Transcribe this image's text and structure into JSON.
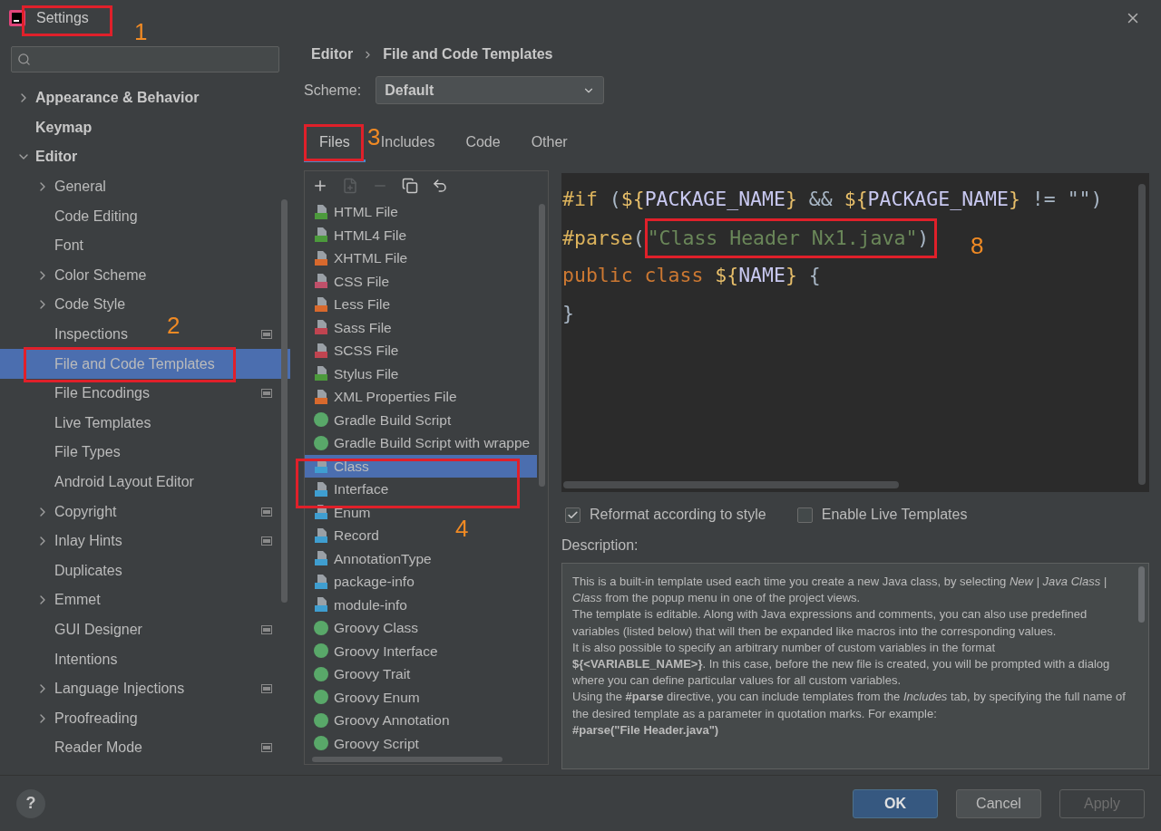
{
  "window": {
    "title": "Settings"
  },
  "sidebar": {
    "items": [
      {
        "label": "Appearance & Behavior",
        "expandable": true,
        "expanded": false,
        "selected": false,
        "project_badge": false
      },
      {
        "label": "Keymap",
        "expandable": false,
        "selected": false,
        "project_badge": false
      },
      {
        "label": "Editor",
        "expandable": true,
        "expanded": true,
        "selected": false,
        "project_badge": false,
        "children": [
          {
            "label": "General",
            "expandable": true,
            "expanded": false,
            "selected": false,
            "project_badge": false
          },
          {
            "label": "Code Editing",
            "expandable": false,
            "selected": false,
            "project_badge": false
          },
          {
            "label": "Font",
            "expandable": false,
            "selected": false,
            "project_badge": false
          },
          {
            "label": "Color Scheme",
            "expandable": true,
            "expanded": false,
            "selected": false,
            "project_badge": false
          },
          {
            "label": "Code Style",
            "expandable": true,
            "expanded": false,
            "selected": false,
            "project_badge": false
          },
          {
            "label": "Inspections",
            "expandable": false,
            "selected": false,
            "project_badge": true
          },
          {
            "label": "File and Code Templates",
            "expandable": false,
            "selected": true,
            "project_badge": false
          },
          {
            "label": "File Encodings",
            "expandable": false,
            "selected": false,
            "project_badge": true
          },
          {
            "label": "Live Templates",
            "expandable": false,
            "selected": false,
            "project_badge": false
          },
          {
            "label": "File Types",
            "expandable": false,
            "selected": false,
            "project_badge": false
          },
          {
            "label": "Android Layout Editor",
            "expandable": false,
            "selected": false,
            "project_badge": false
          },
          {
            "label": "Copyright",
            "expandable": true,
            "expanded": false,
            "selected": false,
            "project_badge": true
          },
          {
            "label": "Inlay Hints",
            "expandable": true,
            "expanded": false,
            "selected": false,
            "project_badge": true
          },
          {
            "label": "Duplicates",
            "expandable": false,
            "selected": false,
            "project_badge": false
          },
          {
            "label": "Emmet",
            "expandable": true,
            "expanded": false,
            "selected": false,
            "project_badge": false
          },
          {
            "label": "GUI Designer",
            "expandable": false,
            "selected": false,
            "project_badge": true
          },
          {
            "label": "Intentions",
            "expandable": false,
            "selected": false,
            "project_badge": false
          },
          {
            "label": "Language Injections",
            "expandable": true,
            "expanded": false,
            "selected": false,
            "project_badge": true
          },
          {
            "label": "Proofreading",
            "expandable": true,
            "expanded": false,
            "selected": false,
            "project_badge": false
          },
          {
            "label": "Reader Mode",
            "expandable": false,
            "selected": false,
            "project_badge": true
          }
        ]
      }
    ]
  },
  "breadcrumb": [
    "Editor",
    "File and Code Templates"
  ],
  "scheme": {
    "label": "Scheme:",
    "value": "Default"
  },
  "tabs": [
    {
      "label": "Files",
      "selected": true
    },
    {
      "label": "Includes",
      "selected": false
    },
    {
      "label": "Code",
      "selected": false
    },
    {
      "label": "Other",
      "selected": false
    }
  ],
  "toolbar": [
    {
      "kind": "add",
      "disabled": false
    },
    {
      "kind": "add-child",
      "disabled": true
    },
    {
      "kind": "remove",
      "disabled": true
    },
    {
      "kind": "copy",
      "disabled": false
    },
    {
      "kind": "reset",
      "disabled": false
    }
  ],
  "templates": [
    {
      "label": "HTML File",
      "kind": "html",
      "selected": false
    },
    {
      "label": "HTML4 File",
      "kind": "html",
      "selected": false
    },
    {
      "label": "XHTML File",
      "kind": "xhtml",
      "selected": false
    },
    {
      "label": "CSS File",
      "kind": "css",
      "selected": false
    },
    {
      "label": "Less File",
      "kind": "less",
      "selected": false
    },
    {
      "label": "Sass File",
      "kind": "sass",
      "selected": false
    },
    {
      "label": "SCSS File",
      "kind": "sass",
      "selected": false
    },
    {
      "label": "Stylus File",
      "kind": "stylus",
      "selected": false
    },
    {
      "label": "XML Properties File",
      "kind": "xml",
      "selected": false
    },
    {
      "label": "Gradle Build Script",
      "kind": "gradle",
      "selected": false
    },
    {
      "label": "Gradle Build Script with wrappe",
      "kind": "gradle",
      "selected": false
    },
    {
      "label": "Class",
      "kind": "java",
      "selected": true
    },
    {
      "label": "Interface",
      "kind": "java",
      "selected": false
    },
    {
      "label": "Enum",
      "kind": "java",
      "selected": false
    },
    {
      "label": "Record",
      "kind": "java",
      "selected": false
    },
    {
      "label": "AnnotationType",
      "kind": "java",
      "selected": false
    },
    {
      "label": "package-info",
      "kind": "java",
      "selected": false
    },
    {
      "label": "module-info",
      "kind": "java",
      "selected": false
    },
    {
      "label": "Groovy Class",
      "kind": "gradle",
      "selected": false
    },
    {
      "label": "Groovy Interface",
      "kind": "gradle",
      "selected": false
    },
    {
      "label": "Groovy Trait",
      "kind": "gradle",
      "selected": false
    },
    {
      "label": "Groovy Enum",
      "kind": "gradle",
      "selected": false
    },
    {
      "label": "Groovy Annotation",
      "kind": "gradle",
      "selected": false
    },
    {
      "label": "Groovy Script",
      "kind": "gradle",
      "selected": false
    }
  ],
  "code": [
    {
      "tokens": [
        {
          "kind": "directive",
          "text": "#if"
        },
        {
          "kind": "plain",
          "text": " ("
        },
        {
          "kind": "brace",
          "text": "${"
        },
        {
          "kind": "var",
          "text": "PACKAGE_NAME"
        },
        {
          "kind": "brace",
          "text": "}"
        },
        {
          "kind": "plain",
          "text": " && "
        },
        {
          "kind": "brace",
          "text": "${"
        },
        {
          "kind": "var",
          "text": "PACKAGE_NAME"
        },
        {
          "kind": "brace",
          "text": "}"
        },
        {
          "kind": "plain",
          "text": " != "
        },
        {
          "kind": "plain",
          "text": "\"\")"
        }
      ]
    },
    {
      "tokens": [
        {
          "kind": "directive",
          "text": "#parse"
        },
        {
          "kind": "plain",
          "text": "(",
          "framed": false
        },
        {
          "kind": "string",
          "text": "\"Class Header Nx1.java\"",
          "framed": true
        },
        {
          "kind": "plain",
          "text": ")",
          "framed": true
        }
      ]
    },
    {
      "tokens": [
        {
          "kind": "keyword",
          "text": "public class "
        },
        {
          "kind": "brace",
          "text": "${"
        },
        {
          "kind": "var",
          "text": "NAME"
        },
        {
          "kind": "brace",
          "text": "}"
        },
        {
          "kind": "plain",
          "text": " {"
        }
      ]
    },
    {
      "tokens": [
        {
          "kind": "plain",
          "text": "}"
        }
      ]
    }
  ],
  "options": [
    {
      "label": "Reformat according to style",
      "checked": true
    },
    {
      "label": "Enable Live Templates",
      "checked": false
    }
  ],
  "description": {
    "label": "Description:",
    "paragraphs": [
      "This is a built-in template used each time you create a new Java class, by selecting *New | Java Class | Class* from the popup menu in one of the project views.",
      "The template is editable. Along with Java expressions and comments, you can also use predefined variables (listed below) that will then be expanded like macros into the corresponding values.",
      "It is also possible to specify an arbitrary number of custom variables in the format **${<VARIABLE_NAME>}**. In this case, before the new file is created, you will be prompted with a dialog where you can define particular values for all custom variables.",
      "Using the **#parse** directive, you can include templates from the *Includes* tab, by specifying the full name of the desired template as a parameter in quotation marks. For example:",
      "**#parse(\"File Header.java\")**"
    ]
  },
  "footer": {
    "help": "?",
    "buttons": [
      {
        "label": "OK",
        "kind": "primary",
        "disabled": false
      },
      {
        "label": "Cancel",
        "kind": "normal",
        "disabled": false
      },
      {
        "label": "Apply",
        "kind": "normal",
        "disabled": true
      }
    ]
  },
  "annotations": [
    {
      "number": "1"
    },
    {
      "number": "2"
    },
    {
      "number": "3"
    },
    {
      "number": "4"
    },
    {
      "number": "8"
    }
  ]
}
